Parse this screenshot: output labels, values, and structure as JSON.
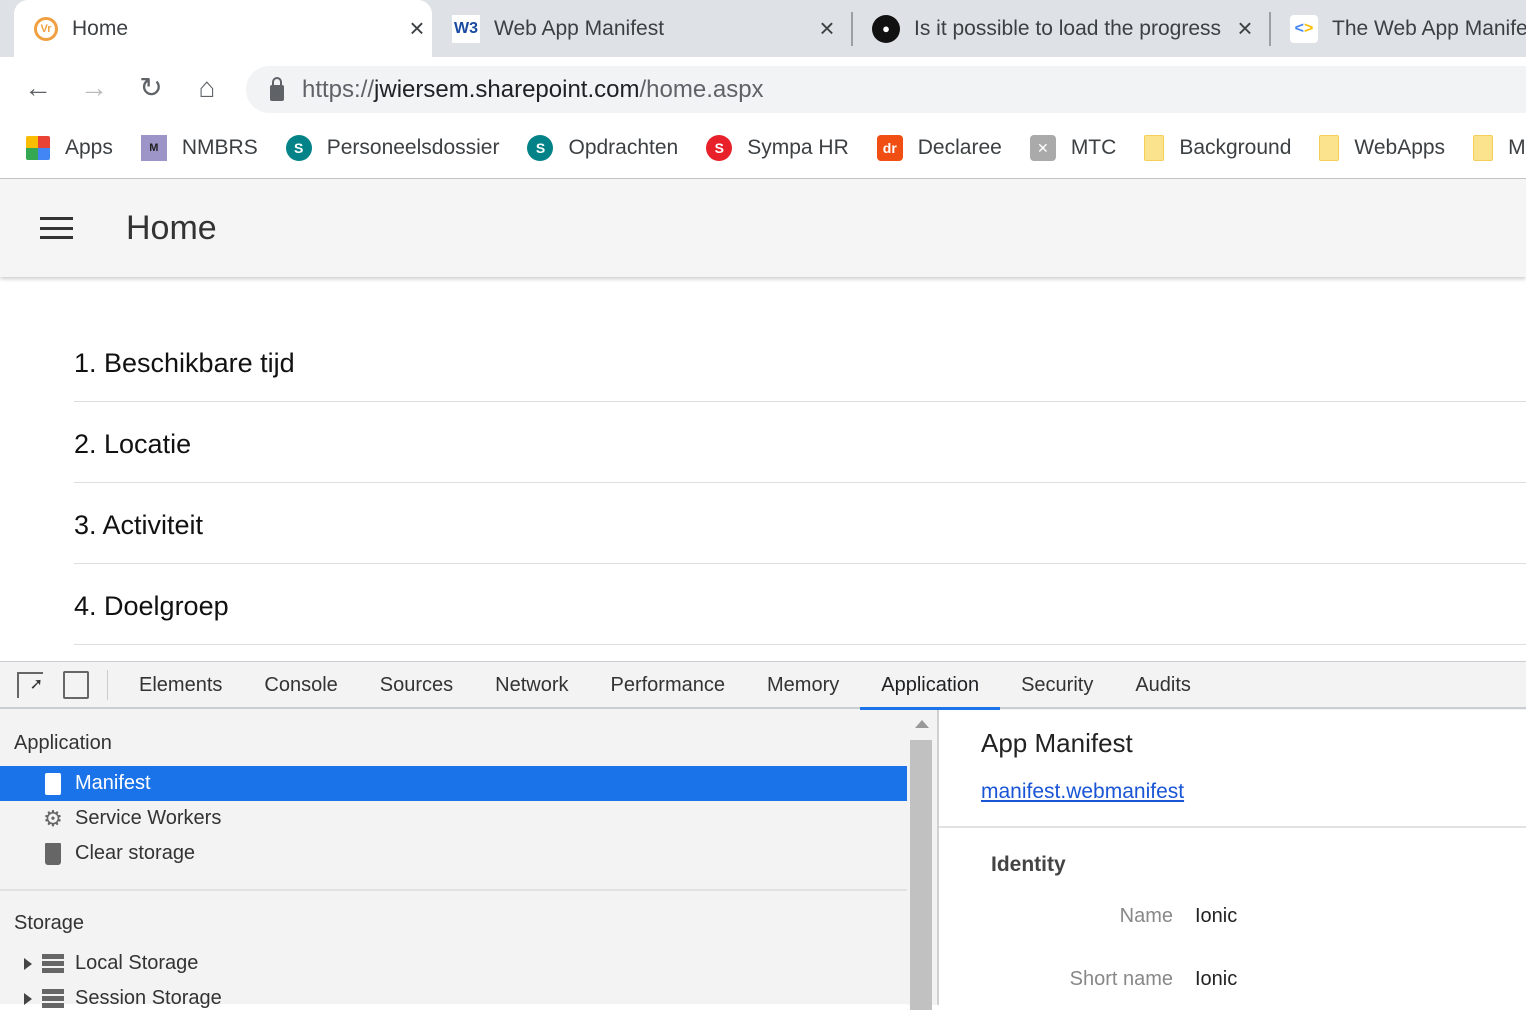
{
  "browser": {
    "tabs": [
      {
        "title": "Home",
        "icon": "vr-logo-icon",
        "active": true
      },
      {
        "title": "Web App Manifest",
        "icon": "w3c-icon"
      },
      {
        "title": "Is it possible to load the progress",
        "icon": "github-icon"
      },
      {
        "title": "The Web App Manife",
        "icon": "google-developers-icon"
      }
    ],
    "url": {
      "scheme": "https://",
      "host": "jwiersem.sharepoint.com",
      "path": "/home.aspx"
    },
    "bookmarks": [
      {
        "label": "Apps",
        "icon": "apps-grid-icon"
      },
      {
        "label": "NMBRS",
        "icon": "nmbrs-icon"
      },
      {
        "label": "Personeelsdossier",
        "icon": "sharepoint-icon"
      },
      {
        "label": "Opdrachten",
        "icon": "sharepoint-icon"
      },
      {
        "label": "Sympa HR",
        "icon": "sympa-icon"
      },
      {
        "label": "Declaree",
        "icon": "declaree-icon"
      },
      {
        "label": "MTC",
        "icon": "mtc-icon"
      },
      {
        "label": "Background",
        "icon": "folder-icon"
      },
      {
        "label": "WebApps",
        "icon": "folder-icon"
      },
      {
        "label": "M",
        "icon": "folder-icon"
      }
    ]
  },
  "app": {
    "title": "Home",
    "items": [
      "1. Beschikbare tijd",
      "2. Locatie",
      "3. Activiteit",
      "4. Doelgroep"
    ]
  },
  "devtools": {
    "tabs": [
      "Elements",
      "Console",
      "Sources",
      "Network",
      "Performance",
      "Memory",
      "Application",
      "Security",
      "Audits"
    ],
    "selected_tab": "Application",
    "sidebar": {
      "application_header": "Application",
      "application_items": [
        "Manifest",
        "Service Workers",
        "Clear storage"
      ],
      "storage_header": "Storage",
      "storage_items": [
        "Local Storage",
        "Session Storage"
      ]
    },
    "manifest": {
      "title": "App Manifest",
      "link": "manifest.webmanifest",
      "section": "Identity",
      "fields": [
        {
          "label": "Name",
          "value": "Ionic"
        },
        {
          "label": "Short name",
          "value": "Ionic"
        }
      ]
    }
  },
  "colors": {
    "accent": "#1a73e8",
    "tabstrip": "#dee1e6"
  }
}
